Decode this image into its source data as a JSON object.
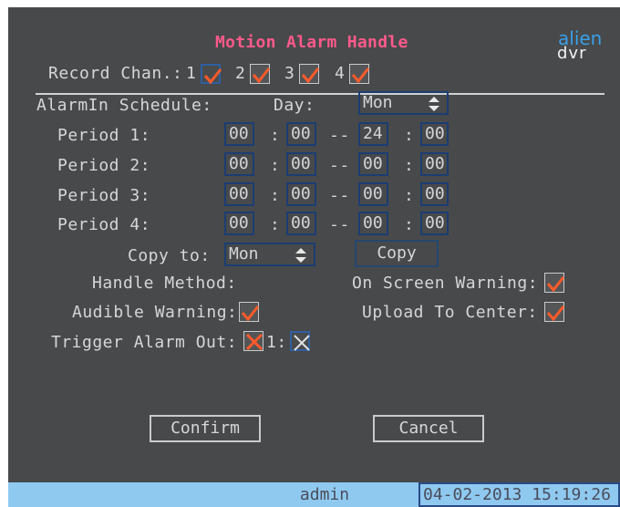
{
  "window": {
    "title": "Motion Alarm Handle"
  },
  "logo": {
    "top": "alien",
    "bottom": "dvr"
  },
  "record_chan": {
    "label": "Record Chan.:",
    "channels": [
      {
        "num": "1",
        "checked": true,
        "focused": true
      },
      {
        "num": "2",
        "checked": true
      },
      {
        "num": "3",
        "checked": true
      },
      {
        "num": "4",
        "checked": true
      }
    ]
  },
  "schedule": {
    "label": "AlarmIn Schedule:",
    "day_label": "Day:",
    "day_value": "Mon"
  },
  "periods": [
    {
      "label": "Period 1:",
      "start_h": "00",
      "start_m": "00",
      "end_h": "24",
      "end_m": "00"
    },
    {
      "label": "Period 2:",
      "start_h": "00",
      "start_m": "00",
      "end_h": "00",
      "end_m": "00"
    },
    {
      "label": "Period 3:",
      "start_h": "00",
      "start_m": "00",
      "end_h": "00",
      "end_m": "00"
    },
    {
      "label": "Period 4:",
      "start_h": "00",
      "start_m": "00",
      "end_h": "00",
      "end_m": "00"
    }
  ],
  "separators": {
    "colon": ":",
    "dash": "--"
  },
  "copy": {
    "label": "Copy to:",
    "value": "Mon",
    "button": "Copy"
  },
  "handle": {
    "label": "Handle Method:",
    "on_screen": {
      "label": "On Screen Warning:",
      "checked": true
    },
    "audible": {
      "label": "Audible Warning:",
      "checked": true
    },
    "upload": {
      "label": "Upload To Center:",
      "checked": true
    },
    "trigger": {
      "label": "Trigger Alarm Out:",
      "checked": true,
      "out_num": "1:",
      "out_checked": false
    }
  },
  "buttons": {
    "confirm": "Confirm",
    "cancel": "Cancel"
  },
  "status": {
    "user": "admin",
    "datetime": "04-02-2013 15:19:26"
  },
  "colors": {
    "background": "#48494a",
    "title": "#ff5a8c",
    "check": "#ff5a2a",
    "border_blue": "#1b3d73",
    "statusbar": "#8fc9f0"
  }
}
